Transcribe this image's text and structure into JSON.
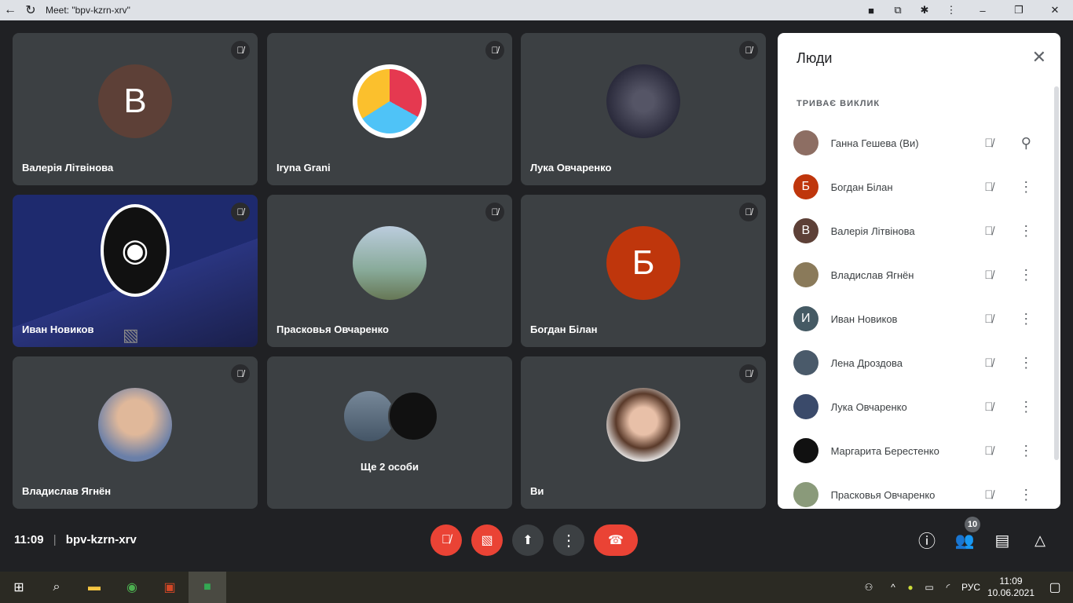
{
  "browser": {
    "title": "Meet: \"bpv-kzrn-xrv\""
  },
  "tiles": [
    {
      "name": "Валерія Літвінова",
      "initial": "В",
      "color": "#5d4037"
    },
    {
      "name": "Iryna Grani"
    },
    {
      "name": "Лука Овчаренко"
    },
    {
      "name": "Иван Новиков"
    },
    {
      "name": "Прасковья Овчаренко"
    },
    {
      "name": "Богдан Білан",
      "initial": "Б",
      "color": "#bf360c"
    },
    {
      "name": "Владислав Ягнён"
    },
    {
      "name": "Ще 2 особи"
    },
    {
      "name": "Ви"
    }
  ],
  "panel": {
    "title": "Люди",
    "section": "ТРИВАЄ ВИКЛИК",
    "people": [
      {
        "name": "Ганна Гешева (Ви)",
        "initial": "",
        "color": "#8d6e63"
      },
      {
        "name": "Богдан Білан",
        "initial": "Б",
        "color": "#bf360c"
      },
      {
        "name": "Валерія Літвінова",
        "initial": "В",
        "color": "#5d4037"
      },
      {
        "name": "Владислав Ягнён",
        "initial": "",
        "color": "#8a7a5a"
      },
      {
        "name": "Иван Новиков",
        "initial": "И",
        "color": "#455a64"
      },
      {
        "name": "Лена Дроздова",
        "initial": "",
        "color": "#4a5a6a"
      },
      {
        "name": "Лука Овчаренко",
        "initial": "",
        "color": "#3a4a6a"
      },
      {
        "name": "Маргарита Берестенко",
        "initial": "",
        "color": "#111"
      },
      {
        "name": "Прасковья Овчаренко",
        "initial": "",
        "color": "#8a9a7a"
      }
    ]
  },
  "bottom": {
    "time": "11:09",
    "code": "bpv-kzrn-xrv",
    "people_count": "10"
  },
  "taskbar": {
    "lang": "РУС",
    "time": "11:09",
    "date": "10.06.2021"
  }
}
